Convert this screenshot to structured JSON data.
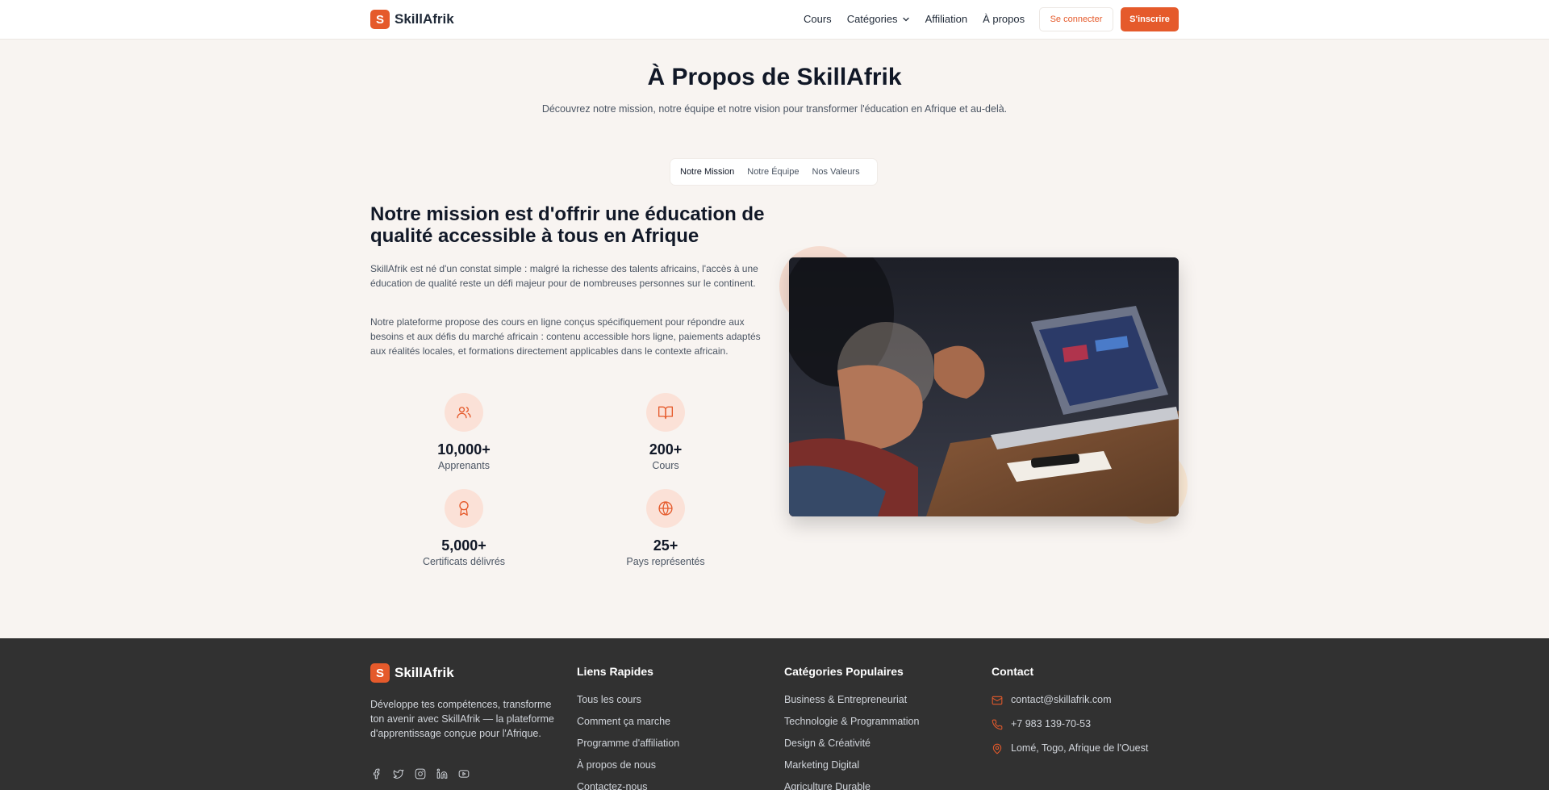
{
  "brand": {
    "logo_letter": "S",
    "name": "SkillAfrik",
    "accent": "#e55a2b"
  },
  "nav": {
    "items": [
      {
        "label": "Cours"
      },
      {
        "label": "Catégories",
        "has_dropdown": true
      },
      {
        "label": "Affiliation"
      },
      {
        "label": "À propos"
      }
    ],
    "login_label": "Se connecter",
    "signup_label": "S'inscrire"
  },
  "hero": {
    "title": "À Propos de SkillAfrik",
    "subtitle": "Découvrez notre mission, notre équipe et notre vision pour transformer l'éducation en Afrique et au-delà."
  },
  "tabs": [
    {
      "label": "Notre Mission",
      "active": true
    },
    {
      "label": "Notre Équipe",
      "active": false
    },
    {
      "label": "Nos Valeurs",
      "active": false
    }
  ],
  "mission": {
    "heading": "Notre mission est d'offrir une éducation de qualité accessible à tous en Afrique",
    "paragraph_1": "SkillAfrik est né d'un constat simple : malgré la richesse des talents africains, l'accès à une éducation de qualité reste un défi majeur pour de nombreuses personnes sur le continent.",
    "paragraph_2": "Notre plateforme propose des cours en ligne conçus spécifiquement pour répondre aux besoins et aux défis du marché africain : contenu accessible hors ligne, paiements adaptés aux réalités locales, et formations directement applicables dans le contexte africain."
  },
  "stats": [
    {
      "icon": "users-icon",
      "value": "10,000+",
      "label": "Apprenants"
    },
    {
      "icon": "book-open-icon",
      "value": "200+",
      "label": "Cours"
    },
    {
      "icon": "award-icon",
      "value": "5,000+",
      "label": "Certificats délivrés"
    },
    {
      "icon": "globe-icon",
      "value": "25+",
      "label": "Pays représentés"
    }
  ],
  "footer": {
    "description": "Développe tes compétences, transforme ton avenir avec SkillAfrik — la plateforme d'apprentissage conçue pour l'Afrique.",
    "social": [
      "facebook-icon",
      "twitter-icon",
      "instagram-icon",
      "linkedin-icon",
      "youtube-icon"
    ],
    "quick_links": {
      "title": "Liens Rapides",
      "items": [
        "Tous les cours",
        "Comment ça marche",
        "Programme d'affiliation",
        "À propos de nous",
        "Contactez-nous"
      ]
    },
    "categories": {
      "title": "Catégories Populaires",
      "items": [
        "Business & Entrepreneuriat",
        "Technologie & Programmation",
        "Design & Créativité",
        "Marketing Digital",
        "Agriculture Durable"
      ]
    },
    "contact": {
      "title": "Contact",
      "email": "contact@skillafrik.com",
      "phone": "+7 983 139-70-53",
      "address": "Lomé, Togo, Afrique de l'Ouest"
    }
  }
}
